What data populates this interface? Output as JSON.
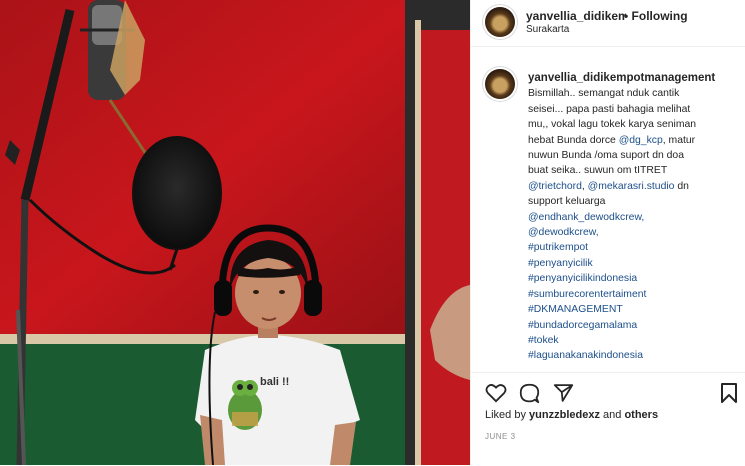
{
  "post": {
    "username": "yanvellia_didikempotmanagement",
    "follow_label": "• Following",
    "location": "Surakarta",
    "caption_lines": [
      "Bismillah.. semangat nduk cantik",
      "seisei... papa pasti bahagia melihat",
      "mu,, vokal lagu tokek karya seniman",
      "hebat Bunda dorce @dg_kcp, matur",
      "nuwun Bunda /oma suport dn doa",
      "buat seika.. suwun om tITRET",
      "@trietchord, @mekarasri.studio dn",
      "support keluarga",
      "@endhank_dewodkcrew,",
      "@dewodkcrew,",
      "#putrikempot",
      "#penyanyicilik",
      "#penyanyicilikindonesia",
      "#sumburecorentertaiment",
      "#DKMANAGEMENT",
      "#bundadorcegamalama",
      "#tokek",
      "#laguanakanakindonesia"
    ],
    "liked_prefix": "Liked by",
    "liked_user": "yunzzbledexz",
    "liked_and": "and",
    "liked_others": "others",
    "date": "JUNE 3"
  },
  "photo": {
    "shirt_text": "bali !!"
  },
  "icons": [
    "heart-icon",
    "comment-icon",
    "share-icon",
    "bookmark-icon"
  ],
  "colors": {
    "link": "#1d4f8a",
    "wall_red": "#c8161c",
    "wall_green": "#1f6b3a"
  }
}
